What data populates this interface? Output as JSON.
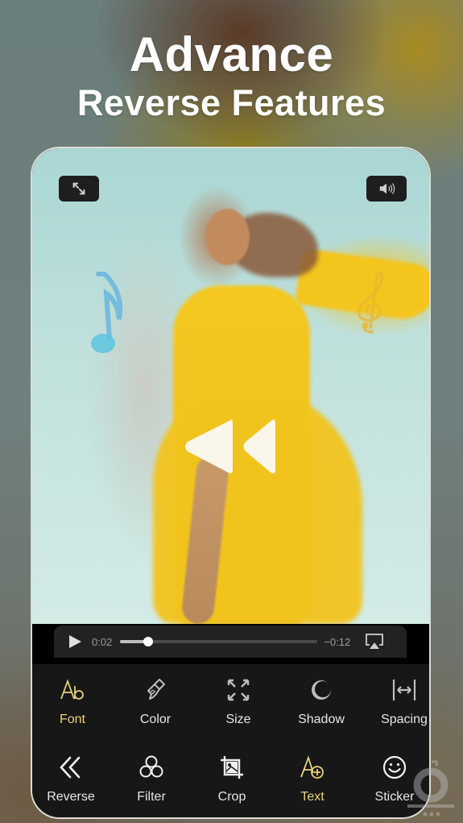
{
  "headline": {
    "line1": "Advance",
    "line2": "Reverse Features"
  },
  "player": {
    "fullscreen_icon": "expand-arrows-icon",
    "volume_icon": "speaker-volume-icon",
    "center_icon": "rewind-icon",
    "decorations": [
      "eighth-note-icon",
      "treble-clef-icon"
    ],
    "current_time": "0:02",
    "remaining_time": "−0:12",
    "progress": 0.14,
    "airplay_icon": "airplay-icon"
  },
  "colors": {
    "accent": "#e8d27a",
    "toolbar_bg": "#171717",
    "label": "#e6e6e6"
  },
  "toolbar": {
    "row1": [
      {
        "label": "Font",
        "icon": "font-ab-icon",
        "active": true
      },
      {
        "label": "Color",
        "icon": "paint-brush-icon",
        "active": false
      },
      {
        "label": "Size",
        "icon": "resize-arrows-icon",
        "active": false
      },
      {
        "label": "Shadow",
        "icon": "shadow-circle-icon",
        "active": false
      },
      {
        "label": "Spacing",
        "icon": "spacing-icon",
        "active": false
      }
    ],
    "row2": [
      {
        "label": "Reverse",
        "icon": "double-chevron-left-icon",
        "active": false
      },
      {
        "label": "Filter",
        "icon": "filter-circles-icon",
        "active": false
      },
      {
        "label": "Crop",
        "icon": "crop-icon",
        "active": false
      },
      {
        "label": "Text",
        "icon": "add-text-icon",
        "active": true
      },
      {
        "label": "Sticker",
        "icon": "smiley-icon",
        "active": false
      }
    ]
  }
}
